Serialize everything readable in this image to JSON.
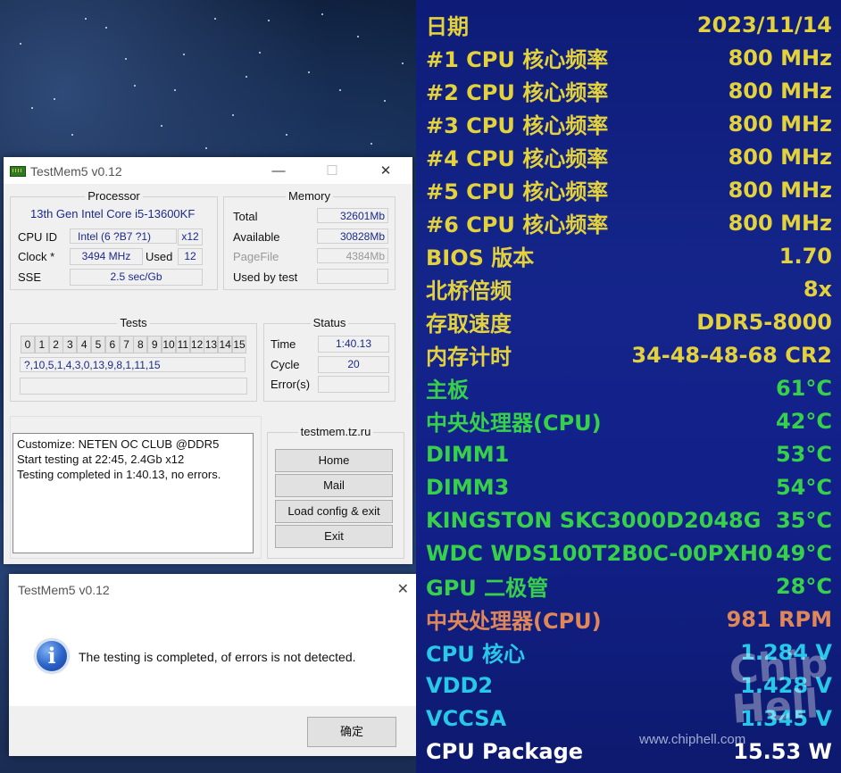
{
  "testmem": {
    "title": "TestMem5 v0.12",
    "window_controls": {
      "minimize": "—",
      "maximize": "☐",
      "close": "✕"
    },
    "processor": {
      "group_title": "Processor",
      "name": "13th Gen Intel Core i5-13600KF",
      "cpu_id_label": "CPU ID",
      "cpu_id_value": "Intel  (6 ?B7 ?1)",
      "threads": "x12",
      "clock_label": "Clock *",
      "clock_value": "3494 MHz",
      "used_label": "Used",
      "used_value": "12",
      "sse_label": "SSE",
      "sse_value": "2.5 sec/Gb"
    },
    "memory": {
      "group_title": "Memory",
      "total_label": "Total",
      "total_value": "32601Mb",
      "available_label": "Available",
      "available_value": "30828Mb",
      "pagefile_label": "PageFile",
      "pagefile_value": "4384Mb",
      "used_by_test_label": "Used by test",
      "used_by_test_value": ""
    },
    "tests": {
      "group_title": "Tests",
      "cells": [
        "0",
        "1",
        "2",
        "3",
        "4",
        "5",
        "6",
        "7",
        "8",
        "9",
        "10",
        "11",
        "12",
        "13",
        "14",
        "15"
      ],
      "sequence": "?,10,5,1,4,3,0,13,9,8,1,11,15",
      "progress": ""
    },
    "status": {
      "group_title": "Status",
      "time_label": "Time",
      "time_value": "1:40.13",
      "cycle_label": "Cycle",
      "cycle_value": "20",
      "errors_label": "Error(s)",
      "errors_value": ""
    },
    "log": [
      "Customize: NETEN OC CLUB @DDR5",
      "Start testing at 22:45, 2.4Gb x12",
      "Testing completed in 1:40.13, no errors."
    ],
    "site": {
      "group_title": "testmem.tz.ru",
      "home": "Home",
      "mail": "Mail",
      "load_config": "Load config & exit",
      "exit": "Exit"
    }
  },
  "dialog": {
    "title": "TestMem5 v0.12",
    "close": "✕",
    "message": "The testing is completed, of errors is not detected.",
    "ok": "确定"
  },
  "osd": {
    "colors": {
      "yellow": "#e3d23c",
      "green": "#36d04a",
      "orange": "#e0875a",
      "cyan": "#27c8e8",
      "white": "#ffffff"
    },
    "rows": [
      {
        "label": "日期",
        "value": "2023/11/14",
        "color": "yellow"
      },
      {
        "label": "#1 CPU 核心频率",
        "value": "800 MHz",
        "color": "yellow"
      },
      {
        "label": "#2 CPU 核心频率",
        "value": "800 MHz",
        "color": "yellow"
      },
      {
        "label": "#3 CPU 核心频率",
        "value": "800 MHz",
        "color": "yellow"
      },
      {
        "label": "#4 CPU 核心频率",
        "value": "800 MHz",
        "color": "yellow"
      },
      {
        "label": "#5 CPU 核心频率",
        "value": "800 MHz",
        "color": "yellow"
      },
      {
        "label": "#6 CPU 核心频率",
        "value": "800 MHz",
        "color": "yellow"
      },
      {
        "label": "BIOS 版本",
        "value": "1.70",
        "color": "yellow"
      },
      {
        "label": "北桥倍频",
        "value": "8x",
        "color": "yellow"
      },
      {
        "label": "存取速度",
        "value": "DDR5-8000",
        "color": "yellow"
      },
      {
        "label": "内存计时",
        "value": "34-48-48-68 CR2",
        "color": "yellow"
      },
      {
        "label": "主板",
        "value": "61°C",
        "color": "green"
      },
      {
        "label": "中央处理器(CPU)",
        "value": "42°C",
        "color": "green"
      },
      {
        "label": "DIMM1",
        "value": "53°C",
        "color": "green"
      },
      {
        "label": "DIMM3",
        "value": "54°C",
        "color": "green"
      },
      {
        "label": "KINGSTON SKC3000D2048G",
        "value": "35°C",
        "color": "green"
      },
      {
        "label": "WDC WDS100T2B0C-00PXH0",
        "value": "49°C",
        "color": "green"
      },
      {
        "label": "GPU 二极管",
        "value": "28°C",
        "color": "green"
      },
      {
        "label": "中央处理器(CPU)",
        "value": "981 RPM",
        "color": "orange"
      },
      {
        "label": "CPU 核心",
        "value": "1.284 V",
        "color": "cyan"
      },
      {
        "label": "VDD2",
        "value": "1.428 V",
        "color": "cyan"
      },
      {
        "label": "VCCSA",
        "value": "1.345 V",
        "color": "cyan"
      },
      {
        "label": "CPU Package",
        "value": "15.53 W",
        "color": "white"
      }
    ],
    "watermark": "Chip Hell",
    "watermark_url": "www.chiphell.com"
  }
}
